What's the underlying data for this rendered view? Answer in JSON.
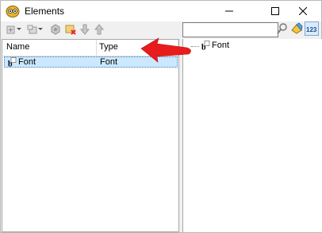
{
  "window": {
    "title": "Elements"
  },
  "list": {
    "columns": [
      "Name",
      "Type"
    ],
    "rows": [
      {
        "name": "Font",
        "type": "Font"
      }
    ]
  },
  "tree": {
    "items": [
      {
        "label": "Font"
      }
    ]
  },
  "search": {
    "value": ""
  },
  "colors": {
    "selection": "#cce8ff",
    "arrow": "#e81c1c"
  },
  "icons": [
    "app-icon",
    "minimize-icon",
    "maximize-icon",
    "close-icon",
    "add-icon",
    "add-child-icon",
    "properties-icon",
    "delete-icon",
    "move-down-icon",
    "move-up-icon",
    "find-icon",
    "clear-icon",
    "numeric-sort-icon",
    "font-icon"
  ]
}
